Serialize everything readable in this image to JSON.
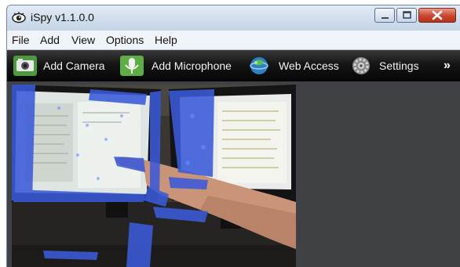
{
  "window": {
    "title": "iSpy v1.1.0.0"
  },
  "icons": {
    "app": "eye-icon",
    "minimize": "minimize-icon",
    "maximize": "maximize-icon",
    "close": "close-icon"
  },
  "menu": {
    "items": [
      "File",
      "Add",
      "View",
      "Options",
      "Help"
    ]
  },
  "toolbar": {
    "items": [
      {
        "label": "Add Camera",
        "icon": "camera-icon"
      },
      {
        "label": "Add Microphone",
        "icon": "microphone-icon"
      },
      {
        "label": "Web Access",
        "icon": "globe-icon"
      },
      {
        "label": "Settings",
        "icon": "gear-icon"
      }
    ],
    "overflow": "»"
  },
  "colors": {
    "window_frame": "#cfdcec",
    "toolbar_bg": "#111111",
    "content_bg": "#3f4144",
    "close_button": "#c9462c",
    "motion_overlay": "#3b5bd9"
  }
}
